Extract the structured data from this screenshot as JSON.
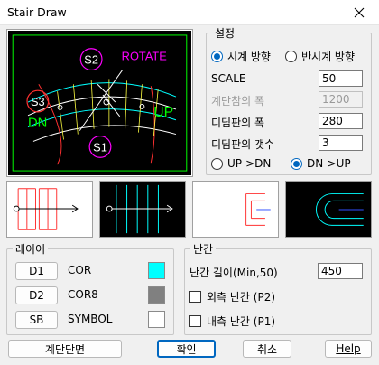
{
  "window": {
    "title": "Stair Draw"
  },
  "preview": {
    "labels": {
      "s1": "S1",
      "s2": "S2",
      "s3": "S3",
      "rotate": "ROTATE",
      "up": "UP",
      "dn": "DN"
    },
    "colors": {
      "background": "#000000",
      "frame": "#00ff00",
      "magenta": "#ff00ff",
      "cyan": "#00ffff",
      "green": "#00ff00",
      "red": "#ff3030",
      "white": "#ffffff",
      "yellow": "#ffff40"
    }
  },
  "settings": {
    "legend": "설정",
    "direction": {
      "clockwise": "시계 방향",
      "counterclockwise": "반시계 방향",
      "selected": "clockwise"
    },
    "scale": {
      "label": "SCALE",
      "value": "50"
    },
    "stair_width": {
      "label": "계단참의 폭",
      "value": "1200",
      "enabled": false
    },
    "tread_width": {
      "label": "디딤판의 폭",
      "value": "280"
    },
    "tread_count": {
      "label": "디딤판의 갯수",
      "value": "3"
    },
    "mode": {
      "up_dn": "UP->DN",
      "dn_up": "DN->UP",
      "selected": "dn_up"
    }
  },
  "thumbnails": [
    {
      "name": "thumb-red-plan",
      "style": "white-bg"
    },
    {
      "name": "thumb-cyan-plan",
      "style": "black-bg"
    },
    {
      "name": "thumb-red-turn",
      "style": "white-bg"
    },
    {
      "name": "thumb-cyan-turn",
      "style": "black-bg"
    }
  ],
  "layers": {
    "legend": "레이어",
    "items": [
      {
        "button": "D1",
        "name": "COR",
        "color": "#00ffff"
      },
      {
        "button": "D2",
        "name": "COR8",
        "color": "#808080"
      },
      {
        "button": "SB",
        "name": "SYMBOL",
        "color": "#ffffff"
      }
    ]
  },
  "railing": {
    "legend": "난간",
    "height": {
      "label": "난간 길이(Min,50)",
      "value": "450"
    },
    "outer": {
      "label": "외측 난간 (P2)",
      "checked": false
    },
    "inner": {
      "label": "내측 난간 (P1)",
      "checked": false
    }
  },
  "buttons": {
    "section": "계단단면",
    "ok": "확인",
    "cancel": "취소",
    "help": "Help"
  },
  "accent_color": "#0067c0"
}
